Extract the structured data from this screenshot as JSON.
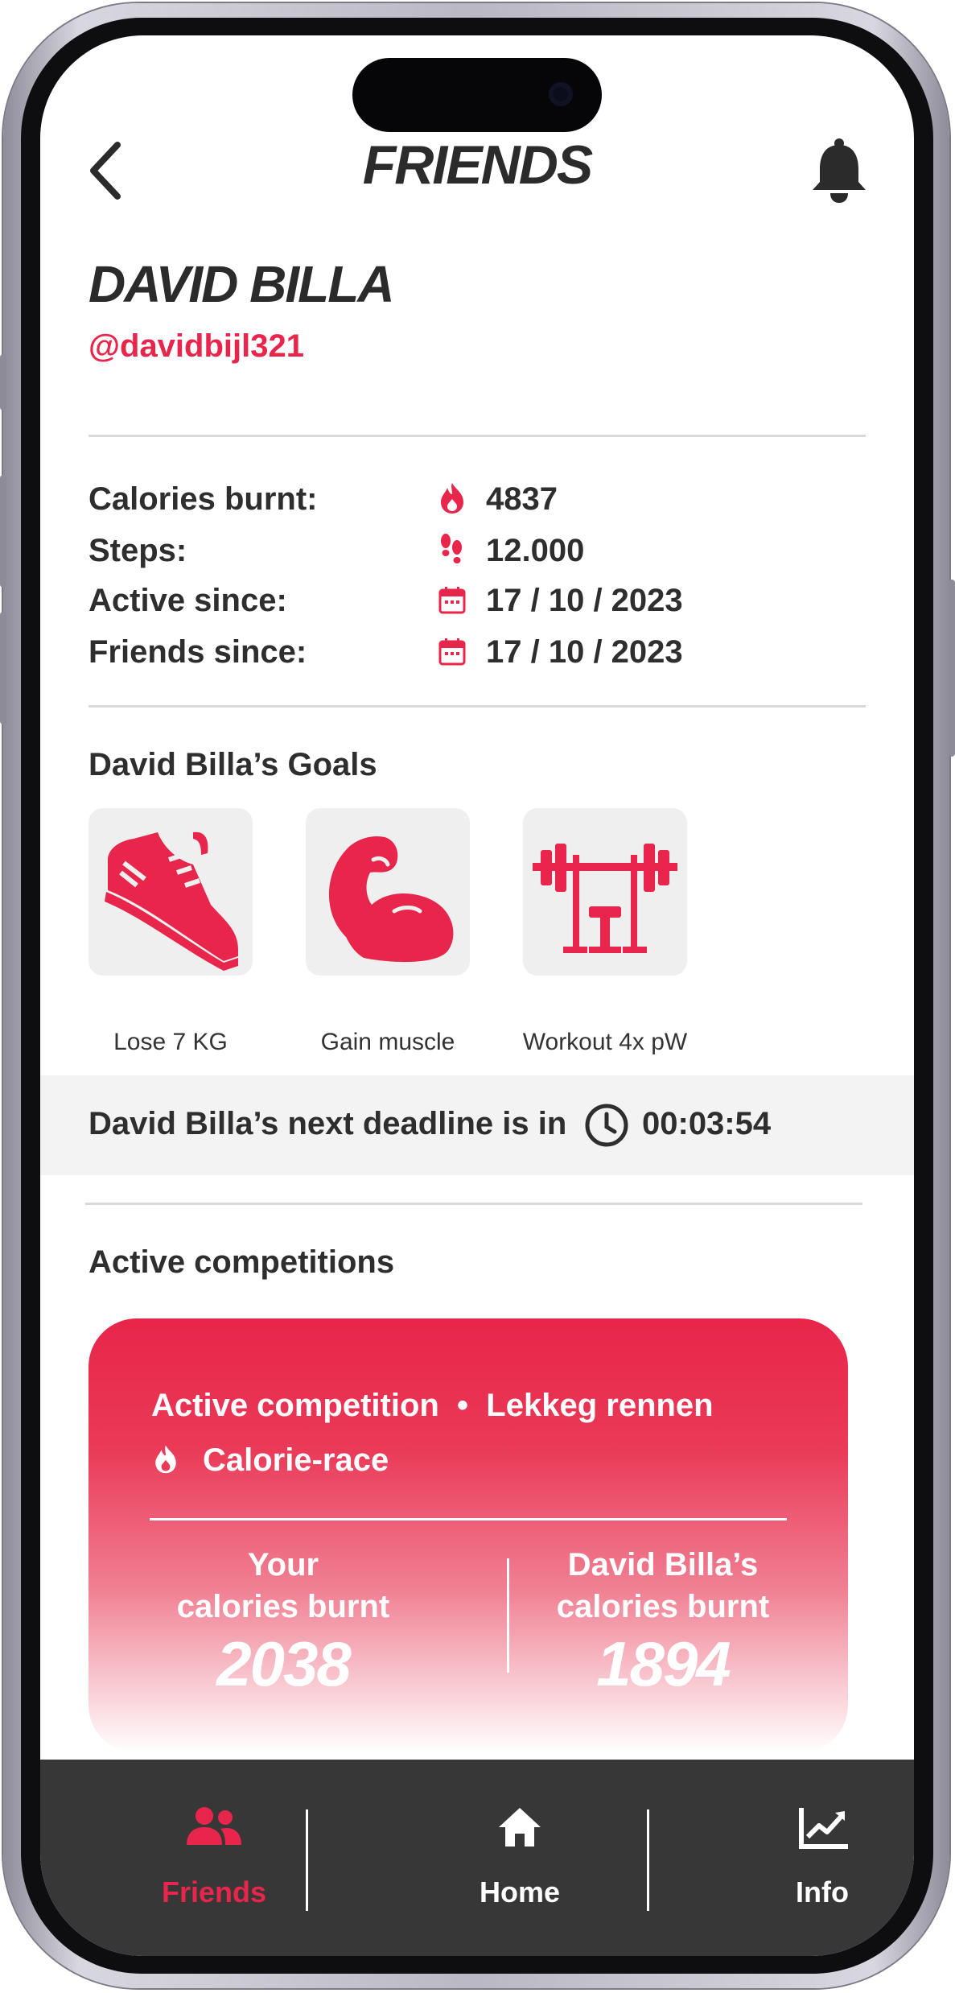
{
  "header": {
    "title": "FRIENDS"
  },
  "profile": {
    "name": "DAVID BILLA",
    "handle": "@davidbijl321"
  },
  "stats": [
    {
      "label": "Calories burnt:",
      "value": "4837",
      "icon": "flame-icon"
    },
    {
      "label": "Steps:",
      "value": "12.000",
      "icon": "footsteps-icon"
    },
    {
      "label": "Active since:",
      "value": "17 / 10 / 2023",
      "icon": "calendar-icon"
    },
    {
      "label": "Friends since:",
      "value": "17 / 10 / 2023",
      "icon": "calendar-icon"
    }
  ],
  "goals": {
    "heading": "David Billa’s Goals",
    "items": [
      {
        "label": "Lose 7 KG",
        "icon": "running-shoe-icon"
      },
      {
        "label": "Gain muscle",
        "icon": "flexed-bicep-icon"
      },
      {
        "label": "Workout 4x pW",
        "icon": "bench-press-icon"
      }
    ]
  },
  "deadline": {
    "text": "David Billa’s next deadline is in",
    "time": "00:03:54"
  },
  "competitions": {
    "heading": "Active competitions",
    "card": {
      "title": "Active competition  •  Lekkeg rennen",
      "type": "Calorie-race",
      "left_label_1": "Your",
      "left_label_2": "calories burnt",
      "left_value": "2038",
      "right_label_1": "David Billa’s",
      "right_label_2": "calories burnt",
      "right_value": "1894"
    }
  },
  "tabbar": {
    "friends": "Friends",
    "home": "Home",
    "info": "Info"
  },
  "colors": {
    "accent": "#e8254a",
    "text": "#2e2e2e",
    "tabbar": "#373737"
  }
}
